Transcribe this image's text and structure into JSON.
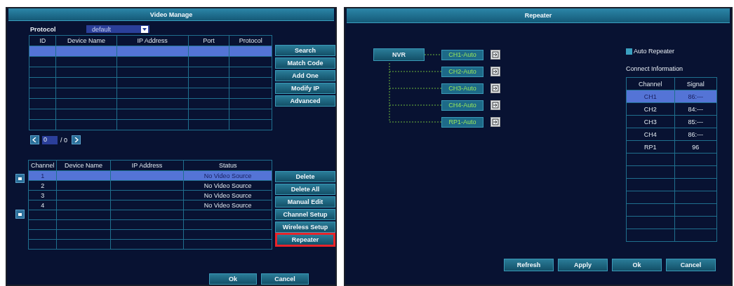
{
  "left_window": {
    "title": "Video Manage",
    "protocol": {
      "label": "Protocol",
      "value": "default"
    },
    "device_table": {
      "columns": [
        "ID",
        "Device Name",
        "IP Address",
        "Port",
        "Protocol"
      ],
      "rows": [
        {
          "selected": true
        }
      ]
    },
    "device_buttons": [
      {
        "label": "Search",
        "highlighted": false
      },
      {
        "label": "Match Code",
        "highlighted": false
      },
      {
        "label": "Add One",
        "highlighted": false
      },
      {
        "label": "Modify IP",
        "highlighted": false
      },
      {
        "label": "Advanced",
        "highlighted": false
      }
    ],
    "pager": {
      "page": "0",
      "total": "/ 0"
    },
    "channel_table": {
      "columns": [
        "Channel",
        "Device Name",
        "IP Address",
        "Status"
      ],
      "rows": [
        {
          "channel": "1",
          "status": "No Video Source",
          "selected": true
        },
        {
          "channel": "2",
          "status": "No Video Source",
          "selected": false
        },
        {
          "channel": "3",
          "status": "No Video Source",
          "selected": false
        },
        {
          "channel": "4",
          "status": "No Video Source",
          "selected": false
        }
      ]
    },
    "channel_buttons": [
      {
        "label": "Delete",
        "highlighted": false
      },
      {
        "label": "Delete All",
        "highlighted": false
      },
      {
        "label": "Manual Edit",
        "highlighted": false
      },
      {
        "label": "Channel Setup",
        "highlighted": false
      },
      {
        "label": "Wireless Setup",
        "highlighted": false
      },
      {
        "label": "Repeater",
        "highlighted": true
      }
    ],
    "footer_buttons": [
      "Ok",
      "Cancel"
    ]
  },
  "right_window": {
    "title": "Repeater",
    "root": "NVR",
    "nodes": [
      {
        "label": "CH1-Auto"
      },
      {
        "label": "CH2-Auto"
      },
      {
        "label": "CH3-Auto"
      },
      {
        "label": "CH4-Auto"
      },
      {
        "label": "RP1-Auto"
      }
    ],
    "auto_repeater": {
      "label": "Auto Repeater",
      "checked": false
    },
    "connect_info": {
      "title": "Connect Information",
      "columns": [
        "Channel",
        "Signal"
      ],
      "rows": [
        {
          "channel": "CH1",
          "signal": "86:---",
          "selected": true
        },
        {
          "channel": "CH2",
          "signal": "84:---",
          "selected": false
        },
        {
          "channel": "CH3",
          "signal": "85:---",
          "selected": false
        },
        {
          "channel": "CH4",
          "signal": "86:---",
          "selected": false
        },
        {
          "channel": "RP1",
          "signal": "96",
          "selected": false
        }
      ]
    },
    "buttons": [
      "Refresh",
      "Apply",
      "Ok",
      "Cancel"
    ]
  }
}
